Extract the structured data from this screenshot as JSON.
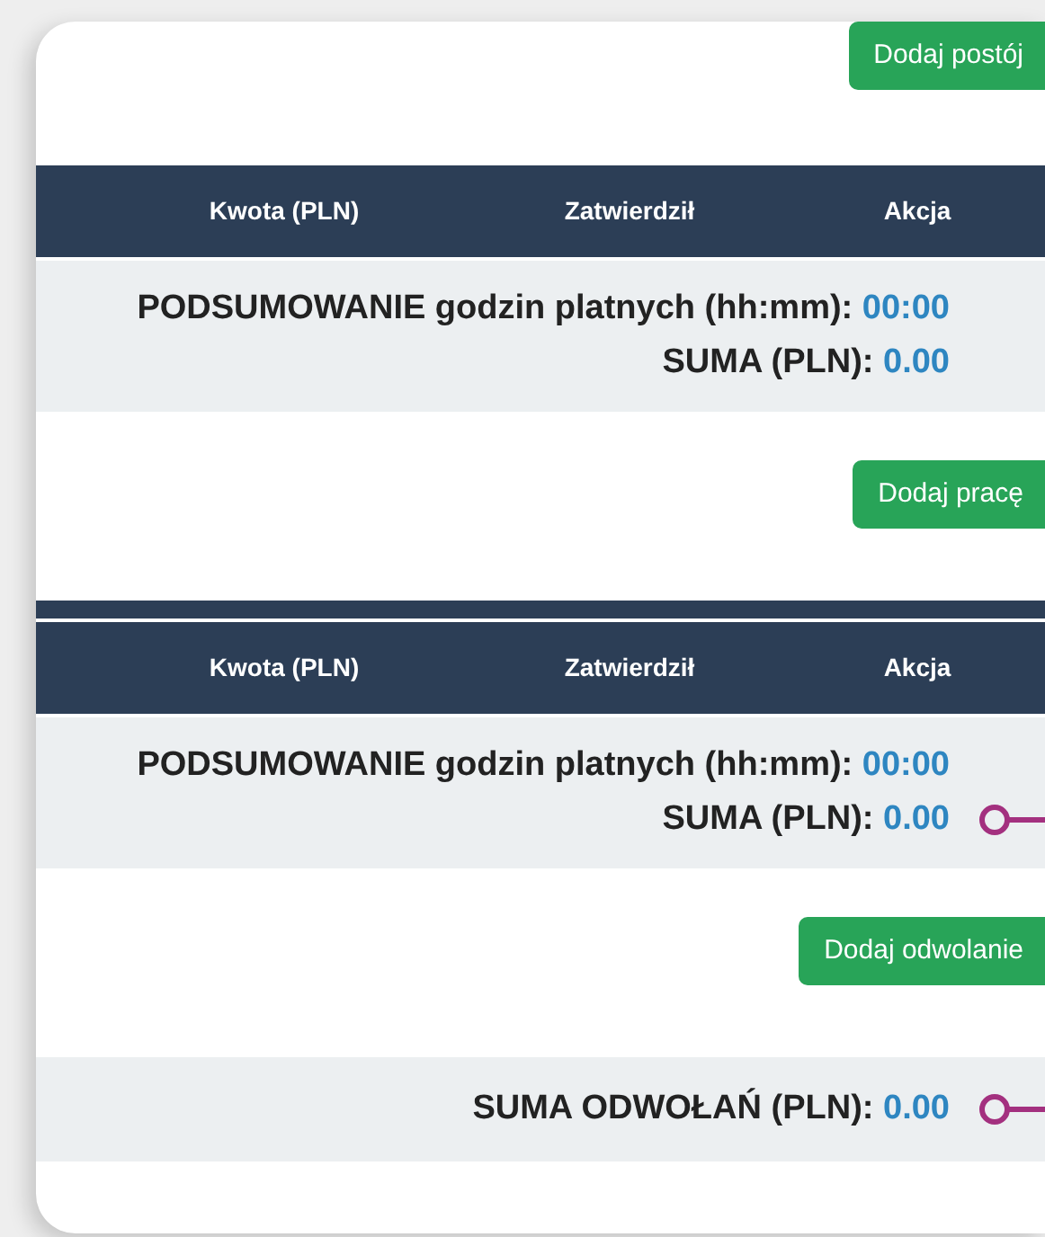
{
  "sections": [
    {
      "kind": "button",
      "label": "Dodaj postój"
    },
    {
      "kind": "table",
      "divider": false,
      "columns": [
        "Kwota (PLN)",
        "Zatwierdził",
        "Akcja"
      ],
      "summary": [
        {
          "label": "PODSUMOWANIE godzin platnych (hh:mm):",
          "value": "00:00",
          "marker": false
        },
        {
          "label": "SUMA (PLN):",
          "value": "0.00",
          "marker": false
        }
      ]
    },
    {
      "kind": "button",
      "label": "Dodaj pracę"
    },
    {
      "kind": "table",
      "divider": true,
      "columns": [
        "Kwota (PLN)",
        "Zatwierdził",
        "Akcja"
      ],
      "summary": [
        {
          "label": "PODSUMOWANIE godzin platnych (hh:mm):",
          "value": "00:00",
          "marker": false
        },
        {
          "label": "SUMA (PLN):",
          "value": "0.00",
          "marker": true
        }
      ]
    },
    {
      "kind": "button",
      "label": "Dodaj odwolanie"
    },
    {
      "kind": "total",
      "summary": [
        {
          "label": "SUMA ODWOŁAŃ (PLN):",
          "value": "0.00",
          "marker": true
        }
      ]
    }
  ]
}
